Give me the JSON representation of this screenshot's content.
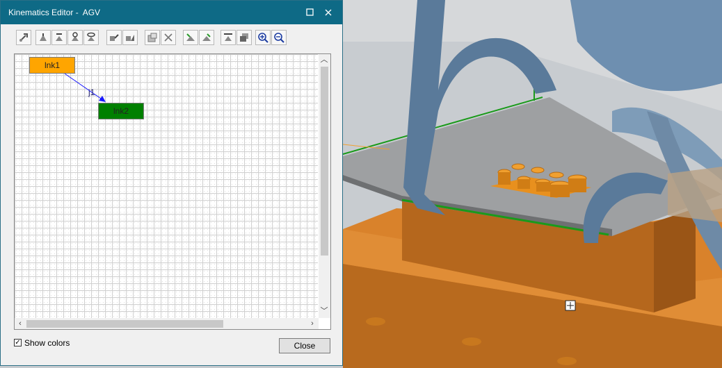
{
  "window": {
    "title": "Kinematics Editor -  AGV",
    "maximize_icon": "maximize-icon",
    "close_icon": "close-icon"
  },
  "toolbar": {
    "buttons": [
      "create-link-icon",
      "create-joint-icon",
      "create-prismatic-icon",
      "create-revolute-icon",
      "create-cam-icon",
      "link-properties-icon",
      "joint-properties-icon",
      "open-icon",
      "delete-icon",
      "fix-icon",
      "unfix-icon",
      "flatten-icon",
      "layers-icon",
      "zoom-in-icon",
      "zoom-out-icon"
    ]
  },
  "diagram": {
    "nodes": [
      {
        "label": "lnk1",
        "color": "#ffa500"
      },
      {
        "label": "lnk2",
        "color": "#008000"
      }
    ],
    "joint_label": "j1",
    "arrow_color": "#1a1aff"
  },
  "options": {
    "show_colors_label": "Show colors",
    "show_colors_checked": true
  },
  "buttons": {
    "close_label": "Close"
  },
  "colors": {
    "titlebar": "#0e6a86",
    "dialog_bg": "#f0f0f0",
    "floor_orange": "#d9822b",
    "frame_blue": "#5a7a9a"
  }
}
